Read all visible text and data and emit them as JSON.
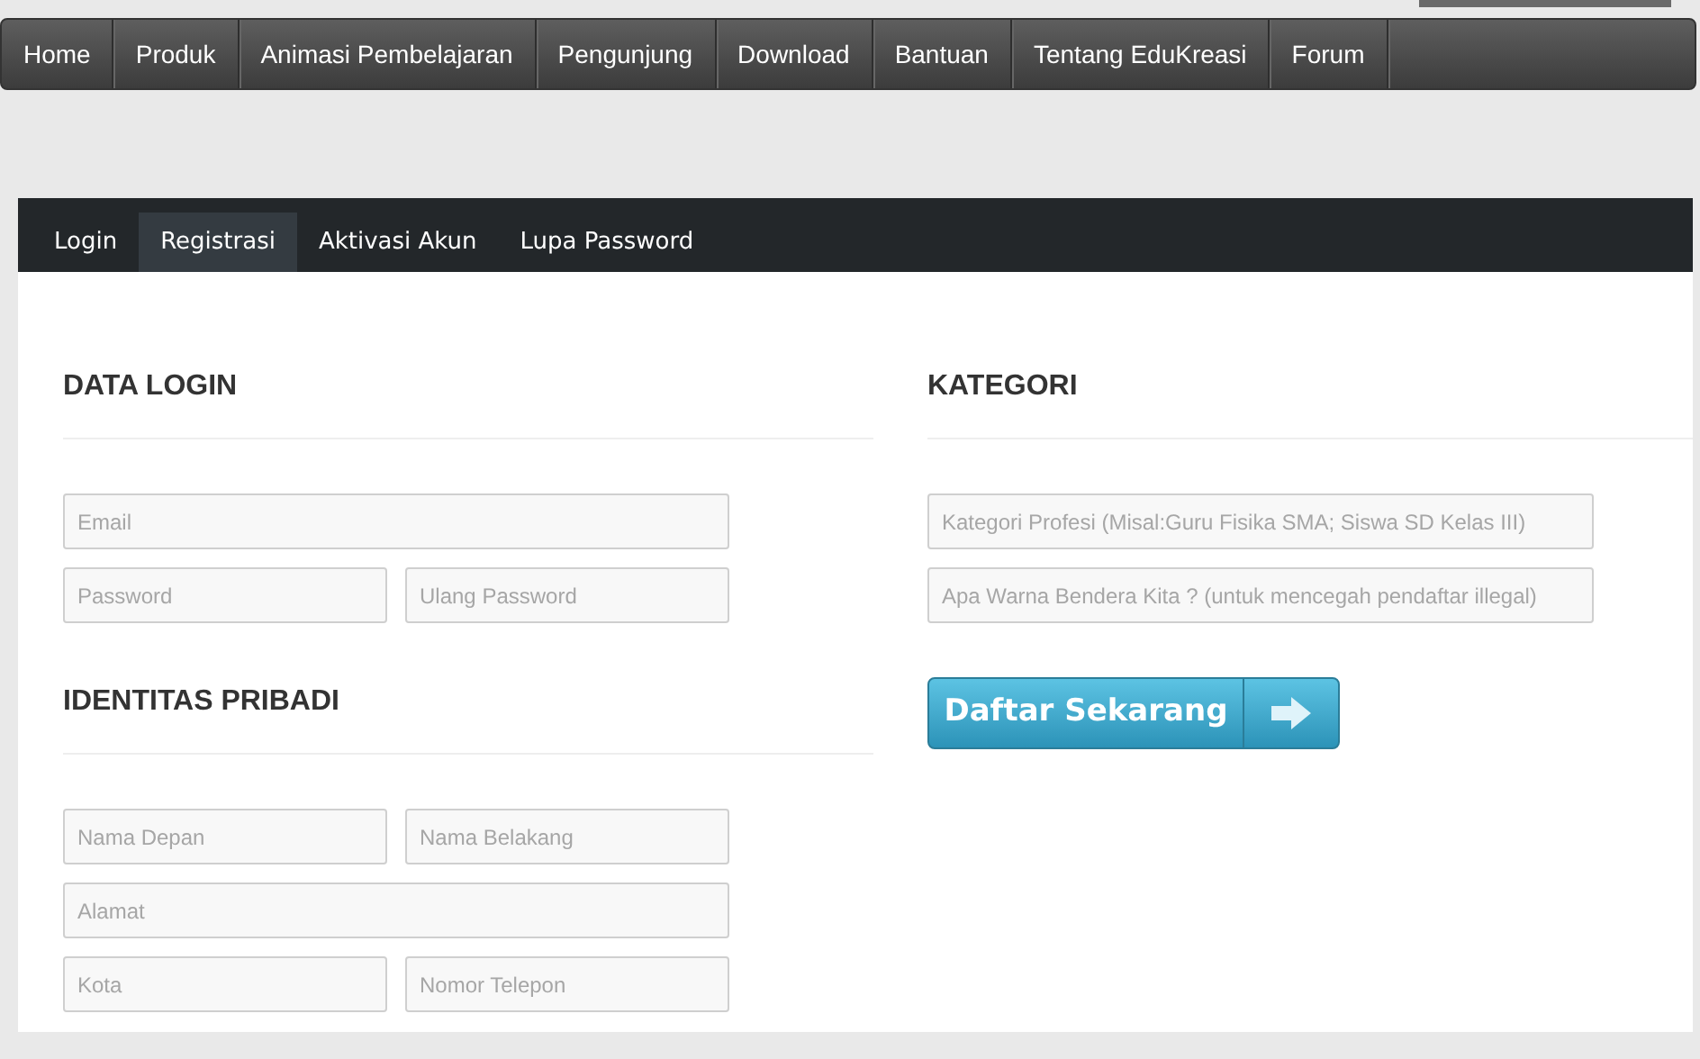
{
  "nav": {
    "items": [
      {
        "label": "Home"
      },
      {
        "label": "Produk"
      },
      {
        "label": "Animasi Pembelajaran"
      },
      {
        "label": "Pengunjung"
      },
      {
        "label": "Download"
      },
      {
        "label": "Bantuan"
      },
      {
        "label": "Tentang EduKreasi"
      },
      {
        "label": "Forum"
      }
    ]
  },
  "tabs": [
    {
      "label": "Login",
      "selected": false
    },
    {
      "label": "Registrasi",
      "selected": true
    },
    {
      "label": "Aktivasi Akun",
      "selected": false
    },
    {
      "label": "Lupa Password",
      "selected": false
    }
  ],
  "left_sections": [
    {
      "heading": "DATA LOGIN",
      "rows": [
        [
          {
            "placeholder": "Email"
          }
        ],
        [
          {
            "placeholder": "Password"
          },
          {
            "placeholder": "Ulang Password"
          }
        ]
      ]
    },
    {
      "heading": "IDENTITAS PRIBADI",
      "rows": [
        [
          {
            "placeholder": "Nama Depan"
          },
          {
            "placeholder": "Nama Belakang"
          }
        ],
        [
          {
            "placeholder": "Alamat"
          }
        ],
        [
          {
            "placeholder": "Kota"
          },
          {
            "placeholder": "Nomor Telepon"
          }
        ]
      ]
    }
  ],
  "right_section": {
    "heading": "KATEGORI",
    "rows": [
      [
        {
          "placeholder": "Kategori Profesi (Misal:Guru Fisika SMA; Siswa SD Kelas III)"
        }
      ],
      [
        {
          "placeholder": "Apa Warna Bendera Kita ? (untuk mencegah pendaftar illegal)"
        }
      ]
    ]
  },
  "submit_button": {
    "label": "Daftar Sekarang"
  }
}
